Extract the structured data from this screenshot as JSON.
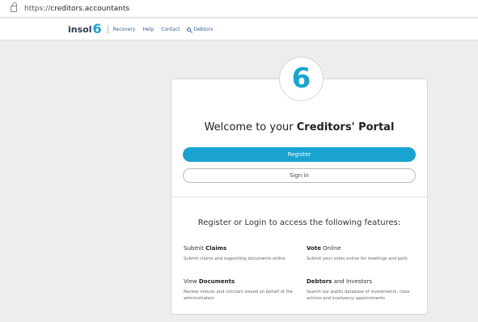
{
  "browser": {
    "url_prefix": "https://",
    "url_host": "creditors.accountants"
  },
  "header": {
    "brand_text": "insol",
    "brand_digit": "6",
    "nav": [
      "Recovery",
      "Help",
      "Contact"
    ],
    "search_label": "Debtors"
  },
  "portal": {
    "logo_digit": "6",
    "welcome_prefix": "Welcome to your ",
    "welcome_bold": "Creditors' Portal",
    "register_label": "Register",
    "signin_label": "Sign in",
    "features_heading": "Register or Login to access the following features:",
    "features": [
      {
        "title_plain": "Submit ",
        "title_bold": "Claims",
        "title_suffix": "",
        "description": "Submit claims and supporting documents online"
      },
      {
        "title_plain": "",
        "title_bold": "Vote",
        "title_suffix": " Online",
        "description": "Submit your votes online for meetings and polls"
      },
      {
        "title_plain": "View ",
        "title_bold": "Documents",
        "title_suffix": "",
        "description": "Review notices and circulars issued on behalf of the administrators"
      },
      {
        "title_plain": "",
        "title_bold": "Debtors",
        "title_suffix": " and Investors",
        "description": "Search our public database of investments, class actions and insolvency appointments"
      }
    ]
  },
  "colors": {
    "accent": "#1aa3d1",
    "nav_link": "#3a5f93",
    "background": "#ededed"
  }
}
